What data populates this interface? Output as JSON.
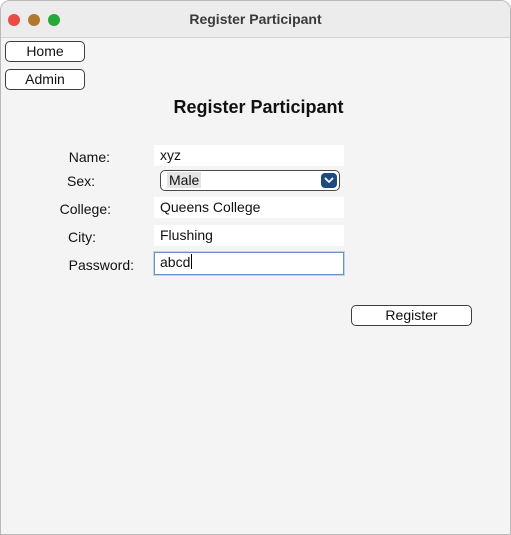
{
  "window": {
    "title": "Register Participant"
  },
  "nav": {
    "home_label": "Home",
    "admin_label": "Admin"
  },
  "form": {
    "heading": "Register Participant",
    "name_label": "Name:",
    "name_value": "xyz",
    "sex_label": "Sex:",
    "sex_value": "Male",
    "college_label": "College:",
    "college_value": "Queens College",
    "city_label": "City:",
    "city_value": "Flushing",
    "password_label": "Password:",
    "password_value": "abcd",
    "register_label": "Register"
  },
  "icons": {
    "close": "close-traffic-light-icon",
    "minimize": "minimize-traffic-light-icon",
    "maximize": "maximize-traffic-light-icon",
    "dropdown": "chevron-down-icon"
  },
  "colors": {
    "close": "#ec4b44",
    "minimize": "#b0792d",
    "maximize": "#27a93a",
    "dropdown_accent": "#1d4b7f",
    "focus_ring": "#6a91c7"
  }
}
